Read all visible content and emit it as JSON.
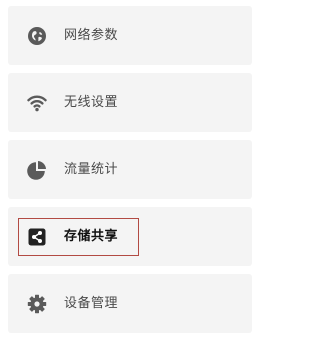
{
  "menu": {
    "active_index": 3,
    "items": [
      {
        "label": "网络参数",
        "icon": "globe-icon"
      },
      {
        "label": "无线设置",
        "icon": "wifi-icon"
      },
      {
        "label": "流量统计",
        "icon": "pie-chart-icon"
      },
      {
        "label": "存储共享",
        "icon": "share-icon"
      },
      {
        "label": "设备管理",
        "icon": "gear-icon"
      }
    ]
  },
  "colors": {
    "item_bg": "#f4f4f4",
    "icon": "#5a5a5a",
    "active_icon": "#222222",
    "label": "#4a4a4a",
    "active_label": "#111111",
    "focus_border": "#b24a43"
  }
}
